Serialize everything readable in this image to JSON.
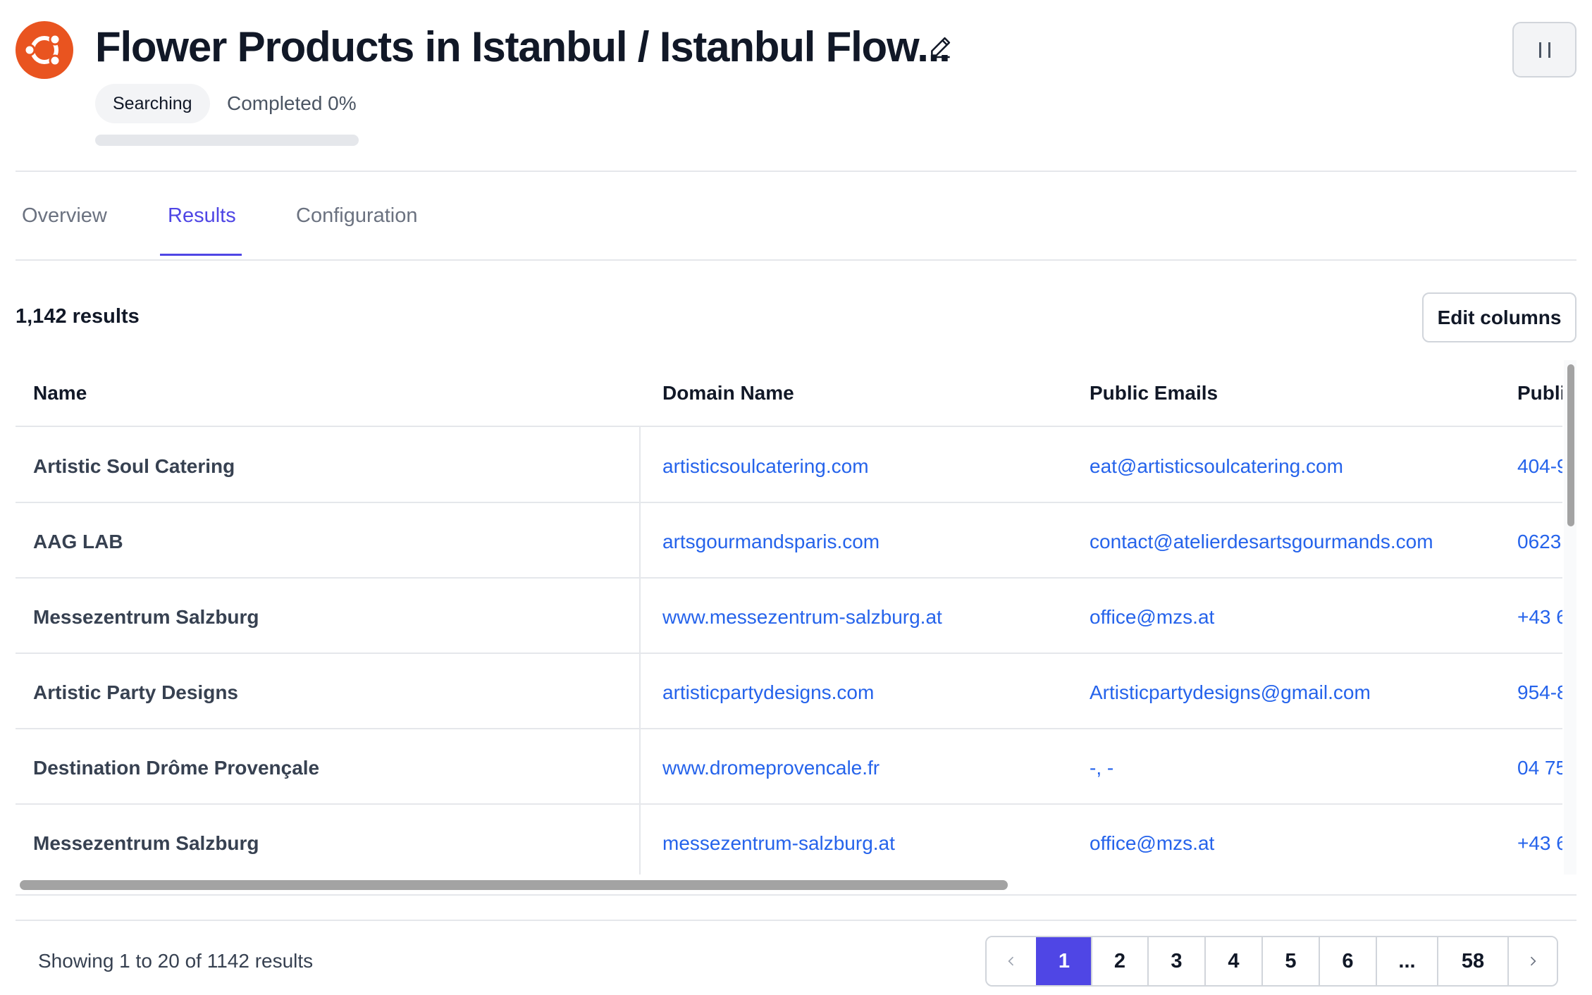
{
  "header": {
    "title": "Flower Products in Istanbul / Istanbul Flow...",
    "status": "Searching",
    "completed_label": "Completed 0%",
    "progress": 0
  },
  "tabs": [
    {
      "label": "Overview",
      "active": false
    },
    {
      "label": "Results",
      "active": true
    },
    {
      "label": "Configuration",
      "active": false
    }
  ],
  "results": {
    "count_label": "1,142 results",
    "edit_columns_label": "Edit columns"
  },
  "table": {
    "columns": [
      "Name",
      "Domain Name",
      "Public Emails",
      "Publi"
    ],
    "rows": [
      {
        "name": "Artistic Soul Catering",
        "domain": "artisticsoulcatering.com",
        "email": "eat@artisticsoulcatering.com",
        "phone": "404-9"
      },
      {
        "name": "AAG LAB",
        "domain": "artsgourmandsparis.com",
        "email": "contact@atelierdesartsgourmands.com",
        "phone": "0623"
      },
      {
        "name": "Messezentrum Salzburg",
        "domain": "www.messezentrum-salzburg.at",
        "email": "office@mzs.at",
        "phone": "+43 6"
      },
      {
        "name": "Artistic Party Designs",
        "domain": "artisticpartydesigns.com",
        "email": "Artisticpartydesigns@gmail.com",
        "phone": "954-8"
      },
      {
        "name": "Destination Drôme Provençale",
        "domain": "www.dromeprovencale.fr",
        "email": "-, -",
        "phone": "04 75"
      },
      {
        "name": "Messezentrum Salzburg",
        "domain": "messezentrum-salzburg.at",
        "email": "office@mzs.at",
        "phone": "+43 6"
      }
    ]
  },
  "footer": {
    "showing": "Showing 1 to 20 of 1142 results",
    "pages": [
      "1",
      "2",
      "3",
      "4",
      "5",
      "6",
      "...",
      "58"
    ],
    "active_page": "1"
  },
  "colors": {
    "accent": "#4f46e5",
    "link": "#2563eb",
    "logo": "#e95420"
  },
  "icons": {
    "logo": "ubuntu-logo-icon",
    "edit": "pencil-icon",
    "pause": "pause-icon",
    "prev": "chevron-left-icon",
    "next": "chevron-right-icon"
  }
}
